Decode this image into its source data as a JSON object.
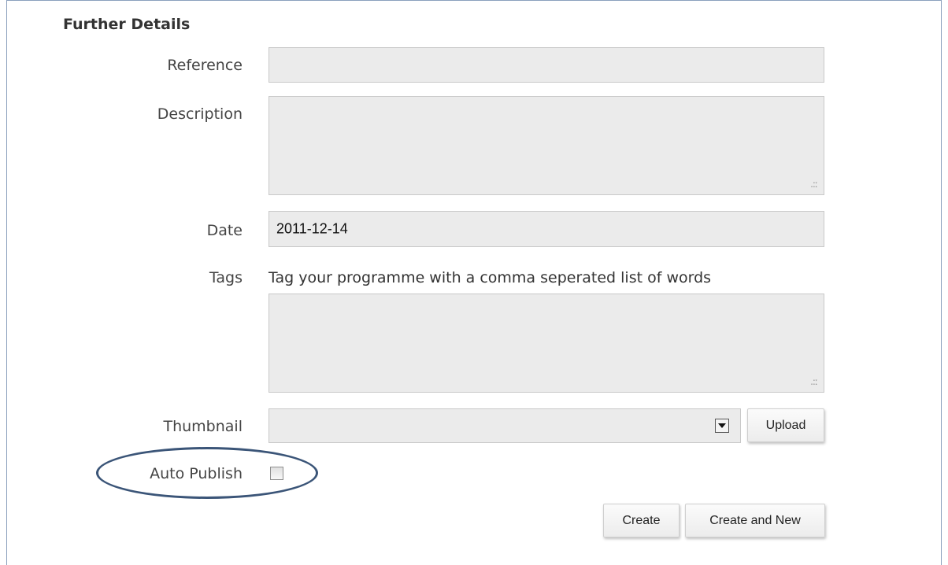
{
  "section": {
    "title": "Further Details"
  },
  "fields": {
    "reference": {
      "label": "Reference",
      "value": ""
    },
    "description": {
      "label": "Description",
      "value": ""
    },
    "date": {
      "label": "Date",
      "value": "2011-12-14"
    },
    "tags": {
      "label": "Tags",
      "hint": "Tag your programme with a comma seperated list of words",
      "value": ""
    },
    "thumbnail": {
      "label": "Thumbnail",
      "value": ""
    },
    "auto_publish": {
      "label": "Auto Publish",
      "checked": false
    }
  },
  "buttons": {
    "upload": "Upload",
    "create": "Create",
    "create_and_new": "Create and New"
  },
  "annotation": {
    "color": "#3b5578"
  },
  "icons": [
    "resize-grip-icon",
    "dropdown-arrow-icon"
  ]
}
